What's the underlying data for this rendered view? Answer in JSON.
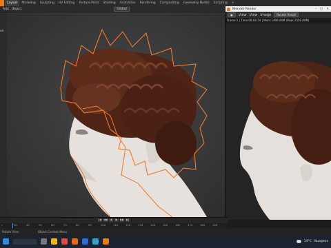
{
  "workspace_tabs": [
    "Layout",
    "Modeling",
    "Sculpting",
    "UV Editing",
    "Texture Paint",
    "Shading",
    "Animation",
    "Rendering",
    "Compositing",
    "Geometry Nodes",
    "Scripting"
  ],
  "header": {
    "add": "Add",
    "object": "Object",
    "transform": "Global"
  },
  "viewport": {
    "mode_label": "ols"
  },
  "render_window": {
    "title": "Blender Render",
    "menu": [
      "View",
      "View",
      "Image"
    ],
    "image_name": "Render Result",
    "info": "Frame:1 | Time:00:04.74 | Mem:1490.44M (Peak 2550.09M)"
  },
  "timeline": {
    "start_label": "r",
    "ruler": [
      "30",
      "40",
      "50",
      "60",
      "70",
      "80",
      "90",
      "100",
      "110",
      "120",
      "130",
      "140",
      "150",
      "160",
      "170",
      "180",
      "190"
    ],
    "transport": [
      "|◀",
      "◀◀",
      "◀",
      "▶",
      "▶▶",
      "▶|"
    ]
  },
  "status": {
    "left": "Rotate View",
    "right": "Object Context Menu"
  },
  "taskbar": {
    "temp": "14°C",
    "weather": "Nuageux"
  },
  "colors": {
    "accent": "#e87d0d",
    "select_outline": "#f07a2a",
    "hair": "#5a2a18",
    "skin": "#e8e2dc"
  }
}
